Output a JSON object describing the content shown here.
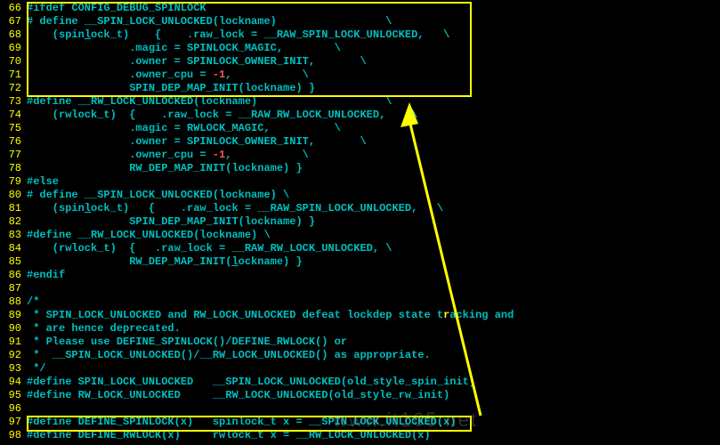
{
  "lines": [
    {
      "n": "66",
      "segs": [
        {
          "c": "preproc",
          "t": "#ifdef CONFIG_DEBUG_SPINLOCK"
        }
      ]
    },
    {
      "n": "67",
      "segs": [
        {
          "c": "preproc",
          "t": "# define __SPIN_LOCK_UNLOCKED(lockname)                 \\"
        }
      ]
    },
    {
      "n": "68",
      "segs": [
        {
          "c": "preproc",
          "t": "    (spin"
        },
        {
          "c": "preproc u",
          "t": "l"
        },
        {
          "c": "preproc",
          "t": "ock_t)    {    .raw_lock = __RAW_SPIN_LOCK_UNLOCKED,   \\"
        }
      ]
    },
    {
      "n": "69",
      "segs": [
        {
          "c": "preproc",
          "t": "                .magic = SPINLOCK_MAGIC,        \\"
        }
      ]
    },
    {
      "n": "70",
      "segs": [
        {
          "c": "preproc",
          "t": "                .owner = SPINLOCK_OWNER_INIT,       \\"
        }
      ]
    },
    {
      "n": "71",
      "segs": [
        {
          "c": "preproc",
          "t": "                .owner_cpu = "
        },
        {
          "c": "num",
          "t": "-1"
        },
        {
          "c": "preproc",
          "t": ",           \\"
        }
      ]
    },
    {
      "n": "72",
      "segs": [
        {
          "c": "preproc",
          "t": "                SPIN_DEP_MAP_INIT(lockname) }"
        }
      ]
    },
    {
      "n": "73",
      "segs": [
        {
          "c": "preproc",
          "t": "#define __RW_LOCK_UNLOCKED(lockname)                    \\"
        }
      ]
    },
    {
      "n": "74",
      "segs": [
        {
          "c": "preproc",
          "t": "    (rwlock_t)  {    .raw_lock = __RAW_RW_LOCK_UNLOCKED,    \\"
        }
      ]
    },
    {
      "n": "75",
      "segs": [
        {
          "c": "preproc",
          "t": "                .magic = RWLOCK_MAGIC,          \\"
        }
      ]
    },
    {
      "n": "76",
      "segs": [
        {
          "c": "preproc",
          "t": "                .owner = SPINLOCK_OWNER_INIT,       \\"
        }
      ]
    },
    {
      "n": "77",
      "segs": [
        {
          "c": "preproc",
          "t": "                .owner_cpu = "
        },
        {
          "c": "num",
          "t": "-1"
        },
        {
          "c": "preproc",
          "t": ",           \\"
        }
      ]
    },
    {
      "n": "78",
      "segs": [
        {
          "c": "preproc",
          "t": "                RW_DEP_MAP_INIT(lockname) }"
        }
      ]
    },
    {
      "n": "79",
      "segs": [
        {
          "c": "preproc",
          "t": "#else"
        }
      ]
    },
    {
      "n": "80",
      "segs": [
        {
          "c": "preproc",
          "t": "# define __SPIN_LOCK_UNLOCKED(lockname) \\"
        }
      ]
    },
    {
      "n": "81",
      "segs": [
        {
          "c": "preproc",
          "t": "    (spin"
        },
        {
          "c": "preproc u",
          "t": "l"
        },
        {
          "c": "preproc",
          "t": "ock_t)   {    .raw_lock = __RAW_SPIN_LOCK_UNLOCKED,   \\"
        }
      ]
    },
    {
      "n": "82",
      "segs": [
        {
          "c": "preproc",
          "t": "                SPIN_DEP_MAP_INIT(lockname) }"
        }
      ]
    },
    {
      "n": "83",
      "segs": [
        {
          "c": "preproc",
          "t": "#define __RW_LOCK_UNLOCKED(lockname) \\"
        }
      ]
    },
    {
      "n": "84",
      "segs": [
        {
          "c": "preproc",
          "t": "    (rwlock_t)  {   .raw_lock = __RAW_RW_LOCK_UNLOCKED, \\"
        }
      ]
    },
    {
      "n": "85",
      "segs": [
        {
          "c": "preproc",
          "t": "                RW_DEP_MAP_INIT("
        },
        {
          "c": "preproc u",
          "t": "l"
        },
        {
          "c": "preproc",
          "t": "ockname) }"
        }
      ]
    },
    {
      "n": "86",
      "segs": [
        {
          "c": "preproc",
          "t": "#endif"
        }
      ]
    },
    {
      "n": "87",
      "segs": []
    },
    {
      "n": "88",
      "segs": [
        {
          "c": "comment",
          "t": "/*"
        }
      ]
    },
    {
      "n": "89",
      "segs": [
        {
          "c": "comment",
          "t": " * SPIN_LOCK_UNLOCKED and RW_LOCK_UNLOCKED defeat lockdep state t"
        },
        {
          "c": "cellipsis",
          "t": "r"
        },
        {
          "c": "comment",
          "t": "acking and"
        }
      ]
    },
    {
      "n": "90",
      "segs": [
        {
          "c": "comment",
          "t": " * are hence deprecated."
        }
      ]
    },
    {
      "n": "91",
      "segs": [
        {
          "c": "comment",
          "t": " * Please use DEFINE_SPINLOCK()/DEFINE_RWLOCK() or"
        }
      ]
    },
    {
      "n": "92",
      "segs": [
        {
          "c": "comment",
          "t": " *  __SPIN_LOCK_UNLOCKED()/__RW_LOCK_UNLOCKED() as appropriate."
        }
      ]
    },
    {
      "n": "93",
      "segs": [
        {
          "c": "comment",
          "t": " */"
        }
      ]
    },
    {
      "n": "94",
      "segs": [
        {
          "c": "preproc",
          "t": "#define SPIN_LOCK_UNLOCKED   __SPIN_LOCK_UNLOCKED(old_style_spin_init)"
        }
      ]
    },
    {
      "n": "95",
      "segs": [
        {
          "c": "preproc",
          "t": "#define RW_LOCK_UNLOCKED     __RW_LOCK_UNLOCKED(old_style_rw_init)"
        }
      ]
    },
    {
      "n": "96",
      "segs": []
    },
    {
      "n": "97",
      "segs": [
        {
          "c": "preproc",
          "t": "#define DEFINE_SPINLOCK(x)   spinlock_t x = __SPIN_LOCK_UNLOCKED(x)"
        }
      ]
    },
    {
      "n": "98",
      "segs": [
        {
          "c": "preproc",
          "t": "#define DEFINE_RWLOCK(x)     rwlock_t x = __RW_LOCK_UNLOCKED(x)"
        }
      ]
    }
  ],
  "watermark": "www.it165.net"
}
